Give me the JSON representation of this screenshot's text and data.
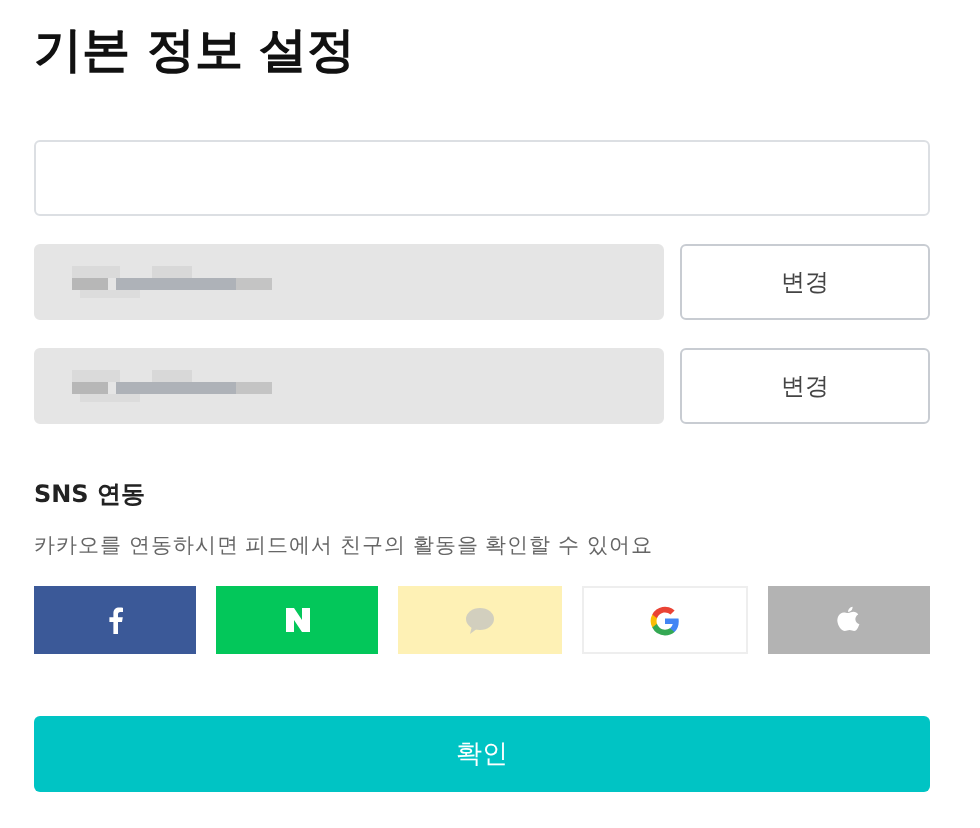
{
  "title": "기본 정보 설정",
  "fields": [
    {
      "kind": "input",
      "disabled": false,
      "redacted": false
    },
    {
      "kind": "with-button",
      "disabled": true,
      "redacted": true,
      "button": "변경"
    },
    {
      "kind": "with-button",
      "disabled": true,
      "redacted": true,
      "button": "변경"
    }
  ],
  "sns": {
    "heading": "SNS 연동",
    "description": "카카오를 연동하시면 피드에서 친구의 활동을 확인할 수 있어요",
    "buttons": [
      {
        "kind": "facebook",
        "color": "#3b5998"
      },
      {
        "kind": "naver",
        "color": "#03c75a"
      },
      {
        "kind": "kakao",
        "color": "#fef1b5"
      },
      {
        "kind": "google",
        "color": "#ffffff"
      },
      {
        "kind": "apple",
        "color": "#b3b3b3"
      }
    ]
  },
  "confirm": "확인"
}
